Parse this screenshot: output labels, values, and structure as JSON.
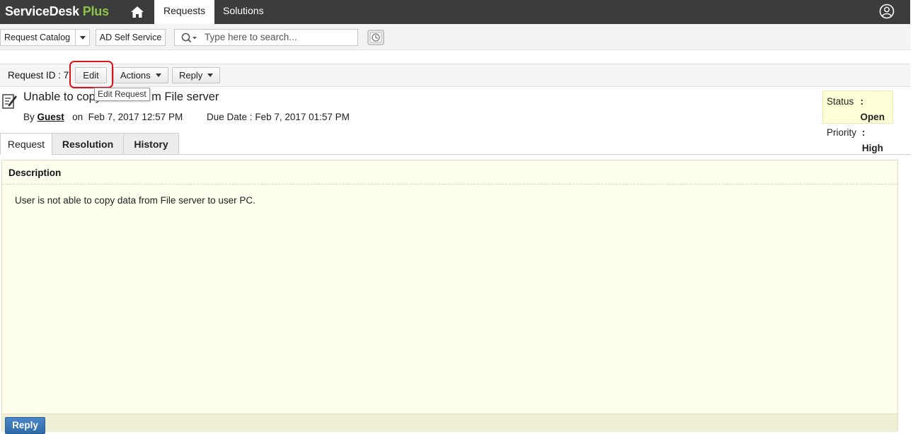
{
  "topbar": {
    "logo_main": "ServiceDesk",
    "logo_accent": "Plus",
    "tabs": [
      {
        "label": "Requests",
        "active": true
      },
      {
        "label": "Solutions",
        "active": false
      }
    ],
    "icons": [
      "home-icon",
      "user-profile-icon"
    ]
  },
  "subbar": {
    "catalog_label": "Request Catalog",
    "ad_self_service_label": "AD Self Service",
    "search_placeholder": "Type here to search...",
    "icons": [
      "search-icon",
      "recent-history-icon"
    ]
  },
  "request": {
    "id_label": "Request ID : 7",
    "buttons": {
      "edit": "Edit",
      "actions": "Actions",
      "reply": "Reply"
    },
    "tooltip": "Edit Request",
    "subject_start": "Unable to copy",
    "subject_end": "m File server",
    "by_label": "By",
    "requester": "Guest",
    "on_label": "on",
    "created": "Feb 7, 2017 12:57 PM",
    "due_label": "Due Date :",
    "due": "Feb 7, 2017 01:57 PM",
    "status_key": "Status",
    "status_value": ": Open",
    "priority_key": "Priority",
    "priority_value": ": High"
  },
  "tabs": [
    {
      "label": "Request",
      "active": true
    },
    {
      "label": "Resolution",
      "active": false
    },
    {
      "label": "History",
      "active": false
    }
  ],
  "description": {
    "heading": "Description",
    "body": "User is not able to copy data from File server to user PC."
  },
  "footer": {
    "reply_label": "Reply"
  },
  "colors": {
    "topbar": "#3c3c3c",
    "logo_accent": "#8bc34a",
    "highlight_ring": "#e0101a",
    "status_box": "#ffffd8",
    "description_bg": "#ffffee",
    "reply_button": "#3a76b6"
  }
}
